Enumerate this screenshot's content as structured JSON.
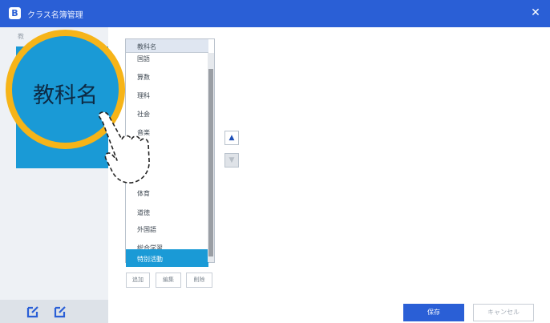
{
  "window": {
    "title": "クラス名簿管理",
    "app_icon_letter": "B",
    "close_glyph": "✕"
  },
  "sidebar": {
    "top_label": "教",
    "footer_icons": [
      "edit-icon",
      "edit-icon"
    ]
  },
  "list": {
    "header": "教科名",
    "items": [
      "国語",
      "算数",
      "理科",
      "社会",
      "音楽",
      "",
      "",
      "",
      "体育",
      "道徳",
      "外国語",
      "総合学習",
      "特別活動"
    ],
    "selected_index": 12
  },
  "controls": {
    "up_glyph": "▲",
    "down_glyph": "▼",
    "small_buttons": [
      "追加",
      "編集",
      "削除"
    ]
  },
  "footer": {
    "primary_label": "保存",
    "secondary_label": "キャンセル"
  },
  "callout": {
    "text": "教科名"
  },
  "colors": {
    "title_bar": "#2a5fd6",
    "selection": "#1a9ad6",
    "callout_ring": "#f6b418"
  }
}
